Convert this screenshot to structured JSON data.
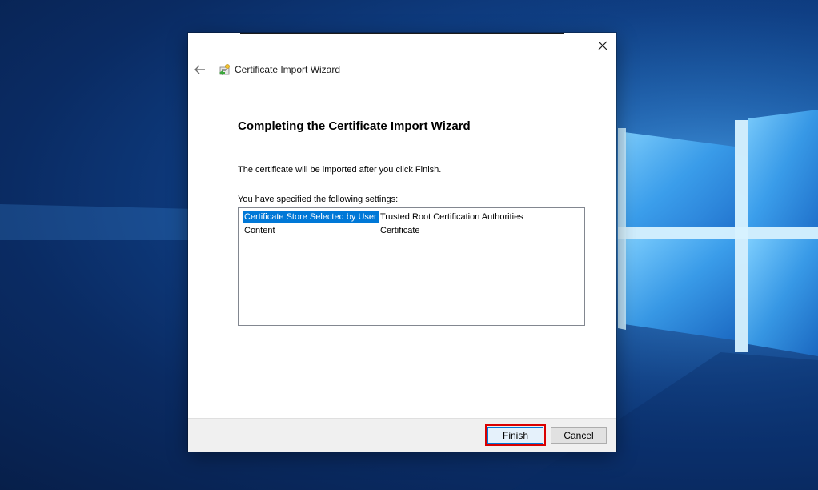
{
  "dialog": {
    "title": "Certificate Import Wizard",
    "heading": "Completing the Certificate Import Wizard",
    "info_text": "The certificate will be imported after you click Finish.",
    "settings_label": "You have specified the following settings:",
    "settings": [
      {
        "key": "Certificate Store Selected by User",
        "value": "Trusted Root Certification Authorities",
        "selected": true
      },
      {
        "key": "Content",
        "value": "Certificate",
        "selected": false
      }
    ],
    "buttons": {
      "finish": "Finish",
      "cancel": "Cancel"
    }
  },
  "icons": {
    "close": "close-icon",
    "back": "back-arrow-icon",
    "wizard": "certificate-wizard-icon"
  },
  "colors": {
    "selection": "#0078d7",
    "highlight": "#d90000",
    "desktop_blue": "#0f3f85"
  }
}
